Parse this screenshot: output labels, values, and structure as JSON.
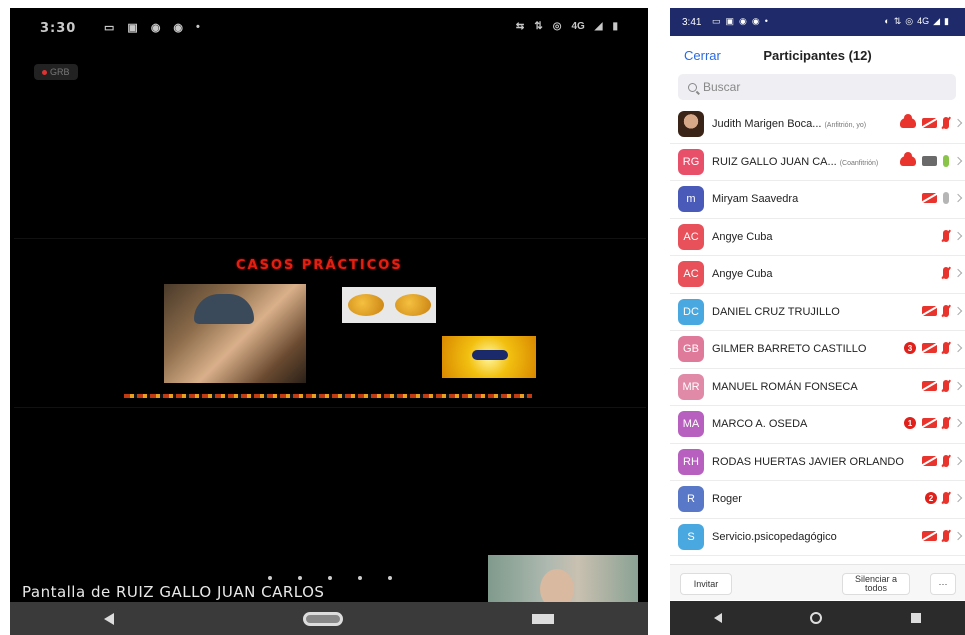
{
  "left_phone": {
    "status": {
      "time": "3:30",
      "left_icons": [
        "▭",
        "▣",
        "◉",
        "◉",
        "•"
      ],
      "right_icons": [
        "⇆",
        "⇅",
        "◎",
        "4G",
        "◢",
        "▮"
      ]
    },
    "recording_badge": "GRB",
    "slide": {
      "title": "CASOS PRÁCTICOS"
    },
    "screen_share_label": "Pantalla de RUIZ GALLO JUAN CARLOS"
  },
  "right_phone": {
    "status": {
      "time": "3:41",
      "left_icons": [
        "▭",
        "▣",
        "◉",
        "◉",
        "•"
      ],
      "right_icons": [
        "◐",
        "⇅",
        "◎",
        "4G",
        "◢",
        "▮"
      ]
    },
    "header": {
      "close_label": "Cerrar",
      "title": "Participantes (12)"
    },
    "search": {
      "placeholder": "Buscar"
    },
    "participants": [
      {
        "initials": "",
        "name": "Judith Marigen Boca...",
        "role": "(Anfitrión, yo)",
        "color": "#b07050",
        "icons": [
          "cloud-icon",
          "video-off-icon",
          "mic-off-icon"
        ]
      },
      {
        "initials": "RG",
        "name": "RUIZ GALLO JUAN CA...",
        "role": "(Coanfitrión)",
        "color": "#e8506a",
        "icons": [
          "cloud-icon",
          "video-on-icon",
          "mic-on-icon"
        ]
      },
      {
        "initials": "m",
        "name": "Miryam Saavedra",
        "role": "",
        "color": "#4a5ab8",
        "icons": [
          "video-off-icon",
          "mic-grey-icon"
        ]
      },
      {
        "initials": "AC",
        "name": "Angye Cuba",
        "role": "",
        "color": "#e8505a",
        "icons": [
          "mic-off-icon"
        ]
      },
      {
        "initials": "AC",
        "name": "Angye Cuba",
        "role": "",
        "color": "#e8505a",
        "icons": [
          "mic-off-icon"
        ]
      },
      {
        "initials": "DC",
        "name": "DANIEL CRUZ TRUJILLO",
        "role": "",
        "color": "#4aa8e0",
        "icons": [
          "video-off-icon",
          "mic-off-icon"
        ]
      },
      {
        "initials": "GB",
        "name": "GILMER BARRETO CASTILLO",
        "role": "",
        "color": "#e07a9a",
        "badge": "3",
        "icons": [
          "video-off-icon",
          "mic-off-icon"
        ]
      },
      {
        "initials": "MR",
        "name": "MANUEL ROMÁN FONSECA",
        "role": "",
        "color": "#e08aa8",
        "icons": [
          "video-off-icon",
          "mic-off-icon"
        ]
      },
      {
        "initials": "MA",
        "name": "MARCO A. OSEDA",
        "role": "",
        "color": "#b860c0",
        "badge": "1",
        "icons": [
          "video-off-icon",
          "mic-off-icon"
        ]
      },
      {
        "initials": "RH",
        "name": "RODAS HUERTAS JAVIER ORLANDO",
        "role": "",
        "color": "#b860c0",
        "icons": [
          "video-off-icon",
          "mic-off-icon"
        ]
      },
      {
        "initials": "R",
        "name": "Roger",
        "role": "",
        "color": "#5a78c8",
        "badge": "2",
        "icons": [
          "mic-off-icon"
        ]
      },
      {
        "initials": "S",
        "name": "Servicio.psicopedagógico",
        "role": "",
        "color": "#4aa8e0",
        "icons": [
          "video-off-icon",
          "mic-off-icon"
        ]
      }
    ],
    "footer": {
      "invite_label": "Invitar",
      "mute_all_label": "Silenciar a todos",
      "more_label": "···"
    }
  }
}
